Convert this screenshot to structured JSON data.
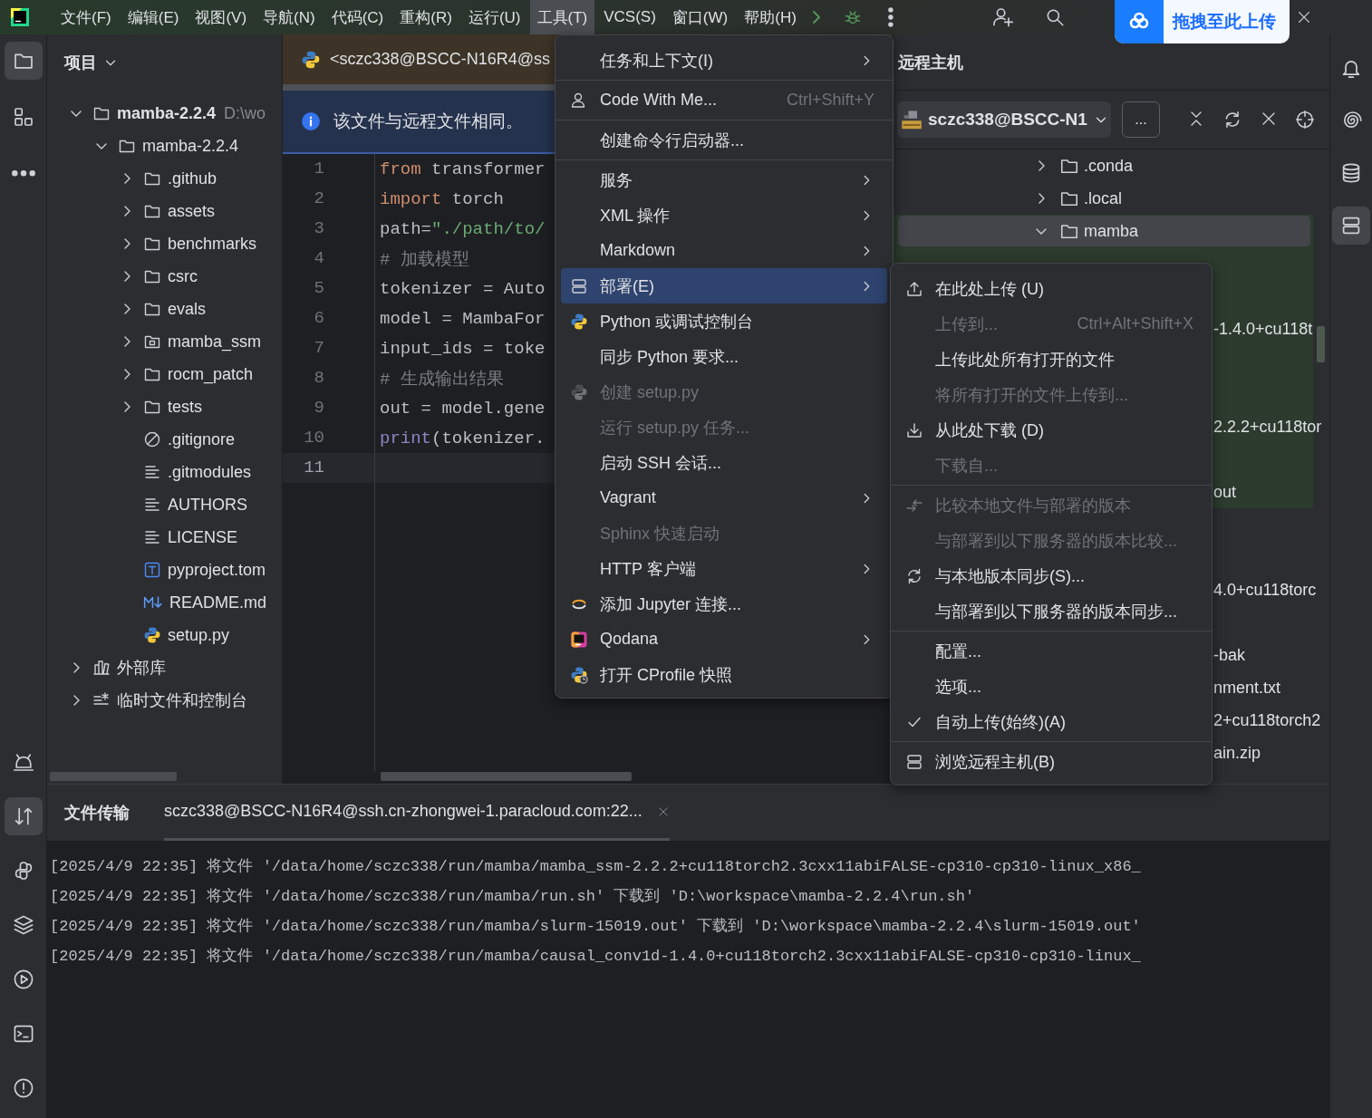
{
  "menu_bar": [
    {
      "label": "文件(F)",
      "selected": false
    },
    {
      "label": "编辑(E)",
      "selected": false
    },
    {
      "label": "视图(V)",
      "selected": false
    },
    {
      "label": "导航(N)",
      "selected": false
    },
    {
      "label": "代码(C)",
      "selected": false
    },
    {
      "label": "重构(R)",
      "selected": false
    },
    {
      "label": "运行(U)",
      "selected": false
    },
    {
      "label": "工具(T)",
      "selected": true
    },
    {
      "label": "VCS(S)",
      "selected": false
    },
    {
      "label": "窗口(W)",
      "selected": false
    },
    {
      "label": "帮助(H)",
      "selected": false
    }
  ],
  "upload_badge": {
    "label": "拖拽至此上传"
  },
  "left_toolbar": {
    "top": [
      {
        "kind": "project",
        "selected": true
      },
      {
        "kind": "structure",
        "selected": false
      },
      {
        "kind": "more",
        "selected": false
      }
    ],
    "bottom": [
      {
        "kind": "assistant",
        "selected": false
      },
      {
        "kind": "transfer",
        "selected": true
      },
      {
        "kind": "python",
        "selected": false
      },
      {
        "kind": "layers",
        "selected": false
      },
      {
        "kind": "run",
        "selected": false
      },
      {
        "kind": "terminal",
        "selected": false
      },
      {
        "kind": "problems",
        "selected": false
      }
    ]
  },
  "right_toolbar": [
    {
      "kind": "notifications",
      "selected": false
    },
    {
      "kind": "spiral",
      "selected": false
    },
    {
      "kind": "database",
      "selected": false
    },
    {
      "kind": "remote",
      "selected": true
    }
  ],
  "project": {
    "title": "项目",
    "tree": [
      {
        "name": "mamba-2.2.4",
        "hint": "D:\\wo",
        "kind": "project",
        "expanded": true,
        "children": [
          {
            "name": "mamba-2.2.4",
            "kind": "folder",
            "expanded": true,
            "children": [
              {
                "name": ".github",
                "kind": "folder",
                "expanded": false
              },
              {
                "name": "assets",
                "kind": "folder",
                "expanded": false
              },
              {
                "name": "benchmarks",
                "kind": "folder",
                "expanded": false
              },
              {
                "name": "csrc",
                "kind": "folder",
                "expanded": false
              },
              {
                "name": "evals",
                "kind": "folder",
                "expanded": false
              },
              {
                "name": "mamba_ssm",
                "kind": "package",
                "expanded": false
              },
              {
                "name": "rocm_patch",
                "kind": "folder",
                "expanded": false
              },
              {
                "name": "tests",
                "kind": "folder",
                "expanded": false
              },
              {
                "name": ".gitignore",
                "kind": "ignore"
              },
              {
                "name": ".gitmodules",
                "kind": "text"
              },
              {
                "name": "AUTHORS",
                "kind": "text"
              },
              {
                "name": "LICENSE",
                "kind": "text"
              },
              {
                "name": "pyproject.tom",
                "kind": "toml"
              },
              {
                "name": "README.md",
                "kind": "markdown"
              },
              {
                "name": "setup.py",
                "kind": "python"
              }
            ]
          }
        ]
      },
      {
        "name": "外部库",
        "kind": "library",
        "expanded": false
      },
      {
        "name": "临时文件和控制台",
        "kind": "scratch",
        "expanded": false
      }
    ]
  },
  "editor": {
    "tab": "<sczc338@BSCC-N16R4@ss",
    "banner": "该文件与远程文件相同。",
    "lines": [
      {
        "number": "1",
        "current": false,
        "tokens": [
          {
            "kind": "keyword",
            "text": "from"
          },
          {
            "kind": "plain",
            "text": " transformer"
          }
        ]
      },
      {
        "number": "2",
        "current": false,
        "tokens": [
          {
            "kind": "keyword",
            "text": "import"
          },
          {
            "kind": "plain",
            "text": " torch"
          }
        ]
      },
      {
        "number": "3",
        "current": false,
        "tokens": [
          {
            "kind": "plain",
            "text": "path="
          },
          {
            "kind": "string",
            "text": "\"./path/to/"
          }
        ]
      },
      {
        "number": "4",
        "current": false,
        "tokens": [
          {
            "kind": "comment",
            "text": "# 加载模型"
          }
        ]
      },
      {
        "number": "5",
        "current": false,
        "tokens": [
          {
            "kind": "plain",
            "text": "tokenizer = Auto"
          }
        ]
      },
      {
        "number": "6",
        "current": false,
        "tokens": [
          {
            "kind": "plain",
            "text": "model = MambaFor"
          }
        ]
      },
      {
        "number": "7",
        "current": false,
        "tokens": [
          {
            "kind": "plain",
            "text": "input_ids = toke"
          }
        ]
      },
      {
        "number": "8",
        "current": false,
        "tokens": [
          {
            "kind": "comment",
            "text": "# 生成输出结果"
          }
        ]
      },
      {
        "number": "9",
        "current": false,
        "tokens": [
          {
            "kind": "plain",
            "text": "out = model.gene"
          }
        ]
      },
      {
        "number": "10",
        "current": false,
        "tokens": [
          {
            "kind": "builtin",
            "text": "print"
          },
          {
            "kind": "plain",
            "text": "(tokenizer."
          }
        ]
      },
      {
        "number": "11",
        "current": true
      }
    ]
  },
  "tools_menu": {
    "groups": [
      [
        {
          "label": "任务和上下文(I)",
          "submenu": true,
          "disabled": false,
          "selected": false
        }
      ],
      [
        {
          "label": "Code With Me...",
          "shortcut": "Ctrl+Shift+Y",
          "submenu": false,
          "disabled": false,
          "selected": false
        }
      ],
      [
        {
          "label": "创建命令行启动器...",
          "submenu": false,
          "disabled": false,
          "selected": false
        }
      ],
      [
        {
          "label": "服务",
          "submenu": true,
          "disabled": false,
          "selected": false
        },
        {
          "label": "XML 操作",
          "submenu": true,
          "disabled": false,
          "selected": false
        },
        {
          "label": "Markdown",
          "submenu": true,
          "disabled": false,
          "selected": false
        },
        {
          "label": "部署(E)",
          "submenu": true,
          "disabled": false,
          "selected": true
        },
        {
          "label": "Python 或调试控制台",
          "submenu": false,
          "disabled": false,
          "selected": false
        },
        {
          "label": "同步 Python 要求...",
          "submenu": false,
          "disabled": false,
          "selected": false
        },
        {
          "label": "创建 setup.py",
          "submenu": false,
          "disabled": true,
          "selected": false
        },
        {
          "label": "运行 setup.py 任务...",
          "submenu": false,
          "disabled": true,
          "selected": false
        },
        {
          "label": "启动 SSH 会话...",
          "submenu": false,
          "disabled": false,
          "selected": false
        },
        {
          "label": "Vagrant",
          "submenu": true,
          "disabled": false,
          "selected": false
        },
        {
          "label": "Sphinx 快速启动",
          "submenu": false,
          "disabled": true,
          "selected": false
        },
        {
          "label": "HTTP 客户端",
          "submenu": true,
          "disabled": false,
          "selected": false
        },
        {
          "label": "添加 Jupyter 连接...",
          "submenu": false,
          "disabled": false,
          "selected": false
        },
        {
          "label": "Qodana",
          "submenu": true,
          "disabled": false,
          "selected": false
        },
        {
          "label": "打开 CProfile 快照",
          "submenu": false,
          "disabled": false,
          "selected": false
        }
      ]
    ]
  },
  "deploy_menu": {
    "groups": [
      [
        {
          "label": "在此处上传 (U)",
          "disabled": false,
          "checked": false
        },
        {
          "label": "上传到...",
          "shortcut": "Ctrl+Alt+Shift+X",
          "disabled": true,
          "checked": false
        },
        {
          "label": "上传此处所有打开的文件",
          "disabled": false,
          "checked": false
        },
        {
          "label": "将所有打开的文件上传到...",
          "disabled": true,
          "checked": false
        },
        {
          "label": "从此处下载 (D)",
          "disabled": false,
          "checked": false
        },
        {
          "label": "下载自...",
          "disabled": true,
          "checked": false
        }
      ],
      [
        {
          "label": "比较本地文件与部署的版本",
          "disabled": true,
          "checked": false
        },
        {
          "label": "与部署到以下服务器的版本比较...",
          "disabled": true,
          "checked": false
        },
        {
          "label": "与本地版本同步(S)...",
          "disabled": false,
          "checked": false
        },
        {
          "label": "与部署到以下服务器的版本同步...",
          "disabled": false,
          "checked": false
        }
      ],
      [
        {
          "label": "配置...",
          "disabled": false,
          "checked": false
        },
        {
          "label": "选项...",
          "disabled": false,
          "checked": false
        },
        {
          "label": "自动上传(始终)(A)",
          "disabled": false,
          "checked": true
        }
      ],
      [
        {
          "label": "浏览远程主机(B)",
          "disabled": false,
          "checked": false
        }
      ]
    ]
  },
  "remote": {
    "title": "远程主机",
    "server": "sczc338@BSCC-N1",
    "more_button": "...",
    "tree": [
      {
        "name": ".conda",
        "kind": "folder",
        "expanded": false,
        "selected": false,
        "changed": false
      },
      {
        "name": ".local",
        "kind": "folder",
        "expanded": false,
        "selected": false,
        "changed": false
      },
      {
        "name": "mamba",
        "kind": "folder",
        "expanded": true,
        "selected": true,
        "changed": true,
        "children": [
          {
            "kind": "hidden",
            "changed": true
          },
          {
            "kind": "hidden",
            "changed": true
          },
          {
            "kind": "partial",
            "name": "-1.4.0+cu118t",
            "changed": true
          },
          {
            "kind": "hidden",
            "changed": true
          },
          {
            "kind": "hidden",
            "changed": true
          },
          {
            "kind": "partial",
            "name": "2.2.2+cu118tor",
            "changed": true
          },
          {
            "kind": "hidden",
            "changed": true
          },
          {
            "kind": "partial",
            "name": "out",
            "changed": true
          },
          {
            "kind": "hidden",
            "changed": false
          },
          {
            "kind": "hidden",
            "changed": false
          },
          {
            "kind": "partial",
            "name": "4.0+cu118torc",
            "changed": false
          },
          {
            "kind": "hidden",
            "changed": false
          },
          {
            "kind": "partial",
            "name": "-bak",
            "changed": false
          },
          {
            "kind": "partial",
            "name": "nment.txt",
            "changed": false
          },
          {
            "kind": "partial",
            "name": "2+cu118torch2",
            "changed": false
          },
          {
            "kind": "partial",
            "name": "ain.zip",
            "changed": false
          }
        ]
      }
    ]
  },
  "transfer": {
    "title": "文件传输",
    "tabs": [
      {
        "label": "sczc338@BSCC-N16R4@ssh.cn-zhongwei-1.paracloud.com:22...",
        "selected": true
      }
    ],
    "log": [
      "[2025/4/9 22:35] 将文件 '/data/home/sczc338/run/mamba/mamba_ssm-2.2.2+cu118torch2.3cxx11abiFALSE-cp310-cp310-linux_x86_",
      "[2025/4/9 22:35] 将文件 '/data/home/sczc338/run/mamba/run.sh' 下载到 'D:\\workspace\\mamba-2.2.4\\run.sh'",
      "[2025/4/9 22:35] 将文件 '/data/home/sczc338/run/mamba/slurm-15019.out' 下载到 'D:\\workspace\\mamba-2.2.4\\slurm-15019.out'",
      "[2025/4/9 22:35] 将文件 '/data/home/sczc338/run/mamba/causal_conv1d-1.4.0+cu118torch2.3cxx11abiFALSE-cp310-cp310-linux_"
    ]
  }
}
